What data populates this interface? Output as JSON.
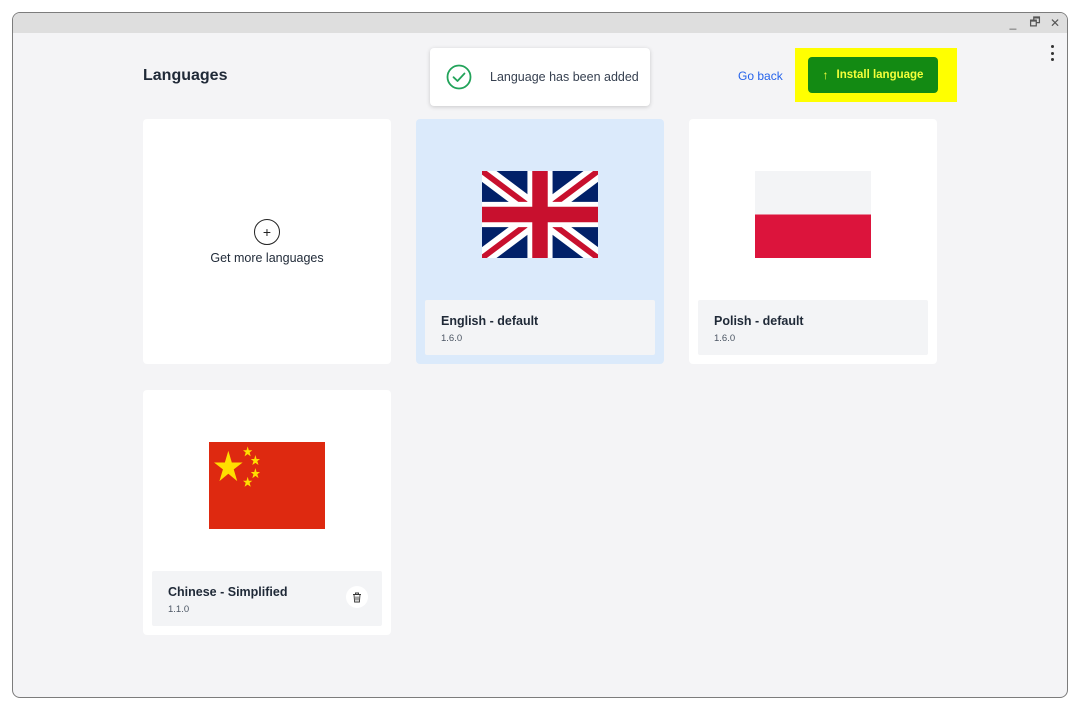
{
  "window": {
    "controls": {
      "minimize": "_",
      "maximize": "🗗",
      "close": "✕"
    }
  },
  "header": {
    "title": "Languages",
    "go_back": "Go back",
    "install_button": "Install language"
  },
  "toast": {
    "message": "Language has been added"
  },
  "get_more": {
    "label": "Get more languages",
    "icon": "plus-circle-icon"
  },
  "languages": [
    {
      "name": "English - default",
      "version": "1.6.0",
      "flag": "uk-flag",
      "selected": true,
      "deletable": false
    },
    {
      "name": "Polish - default",
      "version": "1.6.0",
      "flag": "poland-flag",
      "selected": false,
      "deletable": false
    },
    {
      "name": "Chinese - Simplified",
      "version": "1.1.0",
      "flag": "china-flag",
      "selected": false,
      "deletable": true
    }
  ],
  "colors": {
    "install_bg": "#138a13",
    "install_text": "#f5ff3a",
    "highlight": "#ffff00",
    "selected_card": "#dbeafb",
    "link": "#2563eb",
    "success": "#22a35a"
  }
}
